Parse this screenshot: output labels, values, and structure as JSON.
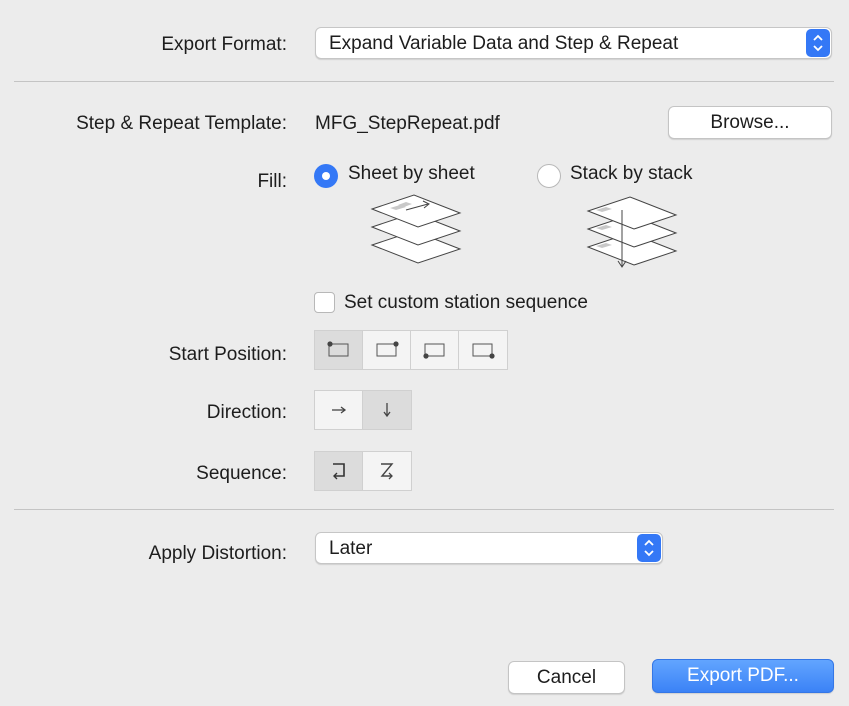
{
  "export_format": {
    "label": "Export Format:",
    "value": "Expand Variable Data and Step & Repeat"
  },
  "template": {
    "label": "Step & Repeat Template:",
    "filename": "MFG_StepRepeat.pdf",
    "browse_label": "Browse..."
  },
  "fill": {
    "label": "Fill:",
    "options": [
      {
        "label": "Sheet by sheet",
        "selected": true
      },
      {
        "label": "Stack by stack",
        "selected": false
      }
    ]
  },
  "custom_sequence": {
    "label": "Set custom station sequence",
    "checked": false
  },
  "start_position": {
    "label": "Start Position:",
    "options": [
      "top-left",
      "top-right",
      "bottom-left",
      "bottom-right"
    ],
    "selected": "top-left"
  },
  "direction": {
    "label": "Direction:",
    "options": [
      "horizontal",
      "vertical"
    ],
    "selected": "vertical"
  },
  "sequence": {
    "label": "Sequence:",
    "options": [
      "return",
      "zigzag"
    ],
    "selected": "return"
  },
  "distortion": {
    "label": "Apply Distortion:",
    "value": "Later"
  },
  "footer": {
    "cancel_label": "Cancel",
    "export_label": "Export PDF..."
  },
  "colors": {
    "accent": "#3478f6",
    "background": "#ececec"
  }
}
